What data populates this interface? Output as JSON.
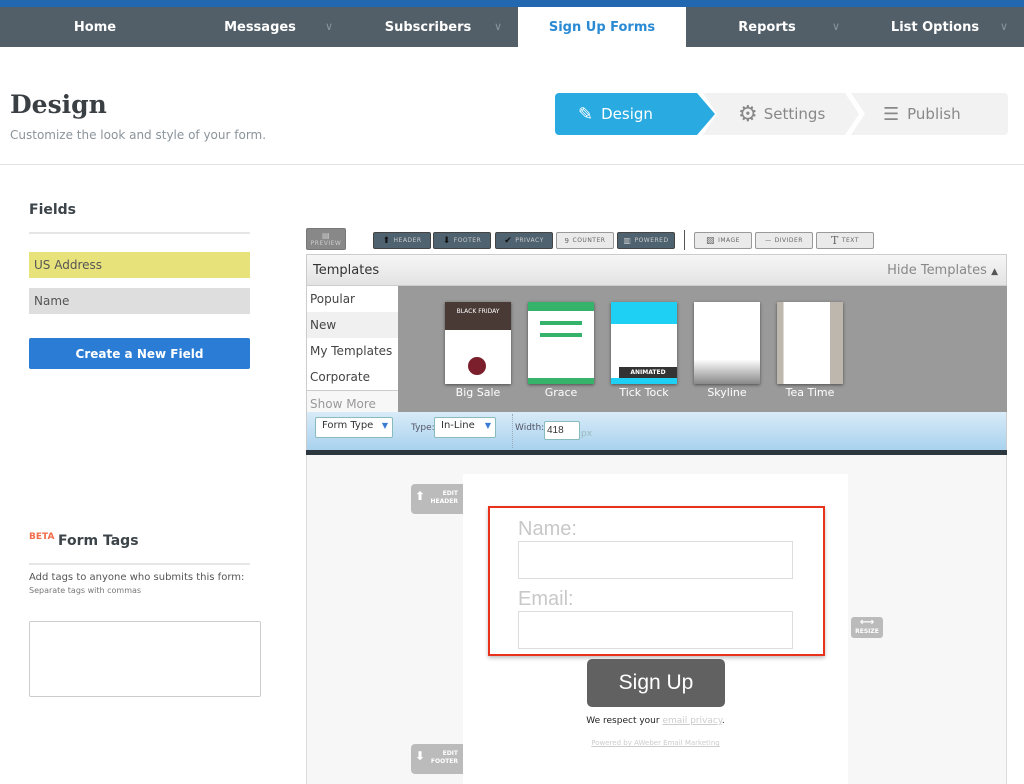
{
  "nav": {
    "tabs": [
      {
        "label": "Home"
      },
      {
        "label": "Messages"
      },
      {
        "label": "Subscribers"
      },
      {
        "label": "Sign Up Forms"
      },
      {
        "label": "Reports"
      },
      {
        "label": "List Options"
      }
    ]
  },
  "header": {
    "title": "Design",
    "subtitle": "Customize the look and style of your form."
  },
  "steps": [
    {
      "label": "Design"
    },
    {
      "label": "Settings"
    },
    {
      "label": "Publish"
    }
  ],
  "fields": {
    "title": "Fields",
    "items": [
      "US Address",
      "Name"
    ],
    "create_label": "Create a New Field"
  },
  "form_tags": {
    "badge": "BETA",
    "title": "Form Tags",
    "description": "Add tags to anyone who submits this form:",
    "hint": "Separate tags with commas",
    "value": ""
  },
  "toolbar": {
    "preview": "PREVIEW",
    "header": "HEADER",
    "footer": "FOOTER",
    "privacy": "PRIVACY",
    "counter": "COUNTER",
    "powered": "POWERED",
    "image": "IMAGE",
    "divider": "DIVIDER",
    "text": "TEXT"
  },
  "templates": {
    "title": "Templates",
    "hide_label": "Hide Templates",
    "categories": [
      "Popular",
      "New",
      "My Templates",
      "Corporate"
    ],
    "show_more": "Show More",
    "items": [
      "Big Sale",
      "Grace",
      "Tick Tock",
      "Skyline",
      "Tea Time"
    ],
    "big_sale_heading": "BLACK FRIDAY",
    "animated_badge": "ANIMATED"
  },
  "form_options": {
    "form_type": "Form Type",
    "type_label": "Type:",
    "type_value": "In-Line",
    "width_label": "Width:",
    "width_value": "418",
    "width_unit": "px"
  },
  "preview": {
    "edit_header": "EDIT HEADER",
    "edit_footer": "EDIT FOOTER",
    "resize": "RESIZE",
    "name_label": "Name:",
    "email_label": "Email:",
    "submit_label": "Sign Up",
    "privacy_prefix": "We respect your ",
    "privacy_link": "email privacy",
    "privacy_suffix": ".",
    "powered_by": "Powered by AWeber Email Marketing"
  },
  "colors": {
    "accent": "#29abe2",
    "nav": "#535f68",
    "highlight_field": "#e8e27a",
    "create_button": "#2a7cd5",
    "selection": "#e8321c"
  }
}
